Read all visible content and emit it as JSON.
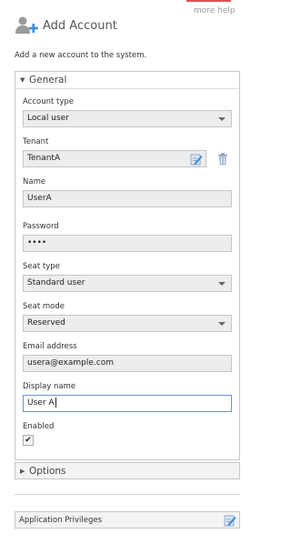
{
  "help": {
    "label": "more help"
  },
  "header": {
    "title": "Add Account",
    "icon": "add-user-icon"
  },
  "description": "Add a new account to the system.",
  "general": {
    "title": "General",
    "fields": {
      "account_type": {
        "label": "Account type",
        "value": "Local user"
      },
      "tenant": {
        "label": "Tenant",
        "value": "TenantA",
        "edit_icon": "edit-icon",
        "delete_icon": "trash-icon"
      },
      "name": {
        "label": "Name",
        "value": "UserA"
      },
      "password": {
        "label": "Password",
        "value": "••••"
      },
      "seat_type": {
        "label": "Seat type",
        "value": "Standard user"
      },
      "seat_mode": {
        "label": "Seat mode",
        "value": "Reserved"
      },
      "email": {
        "label": "Email address",
        "value": "usera@example.com"
      },
      "display_name": {
        "label": "Display name",
        "value": "User A"
      },
      "enabled": {
        "label": "Enabled",
        "checked": true,
        "mark": "✔"
      }
    }
  },
  "options": {
    "title": "Options"
  },
  "privileges": {
    "title": "Application Privileges",
    "icon": "edit-icon"
  },
  "colors": {
    "accent": "#e04f4f",
    "active_border": "#6a96c8",
    "icon_blue": "#3a8fd6"
  }
}
